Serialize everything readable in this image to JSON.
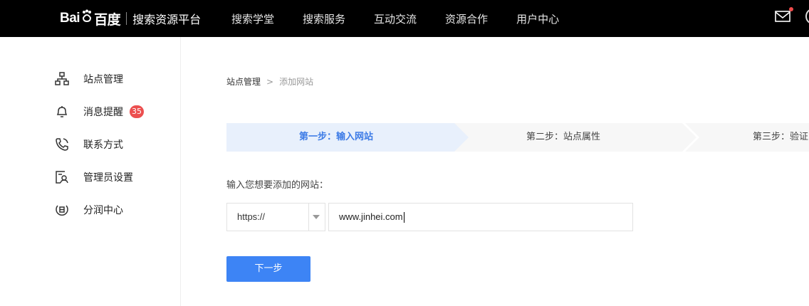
{
  "header": {
    "logo_left": "Bai",
    "logo_right": "百度",
    "platform_name": "搜索资源平台",
    "nav": [
      "搜索学堂",
      "搜索服务",
      "互动交流",
      "资源合作",
      "用户中心"
    ],
    "icons": {
      "mail": "mail-icon",
      "notification_dot": "red-dot"
    }
  },
  "sidebar": {
    "items": [
      {
        "label": "站点管理",
        "icon": "sitemap-icon"
      },
      {
        "label": "消息提醒",
        "icon": "bell-icon",
        "badge": "35"
      },
      {
        "label": "联系方式",
        "icon": "phone-icon"
      },
      {
        "label": "管理员设置",
        "icon": "admin-icon"
      },
      {
        "label": "分润中心",
        "icon": "revenue-icon"
      }
    ]
  },
  "breadcrumb": {
    "root": "站点管理",
    "separator": ">",
    "current": "添加网站"
  },
  "steps": [
    "第一步：输入网站",
    "第二步：站点属性",
    "第三步：验证"
  ],
  "form": {
    "prompt": "输入您想要添加的网站：",
    "protocol": "https://",
    "url_value": "www.jinhei.com",
    "next_label": "下一步"
  },
  "colors": {
    "accent": "#3d84f5",
    "active_step_text": "#3d7be6",
    "active_step_bg": "#e8f0fc",
    "badge": "#ec4f4f",
    "topbar": "#000000"
  }
}
